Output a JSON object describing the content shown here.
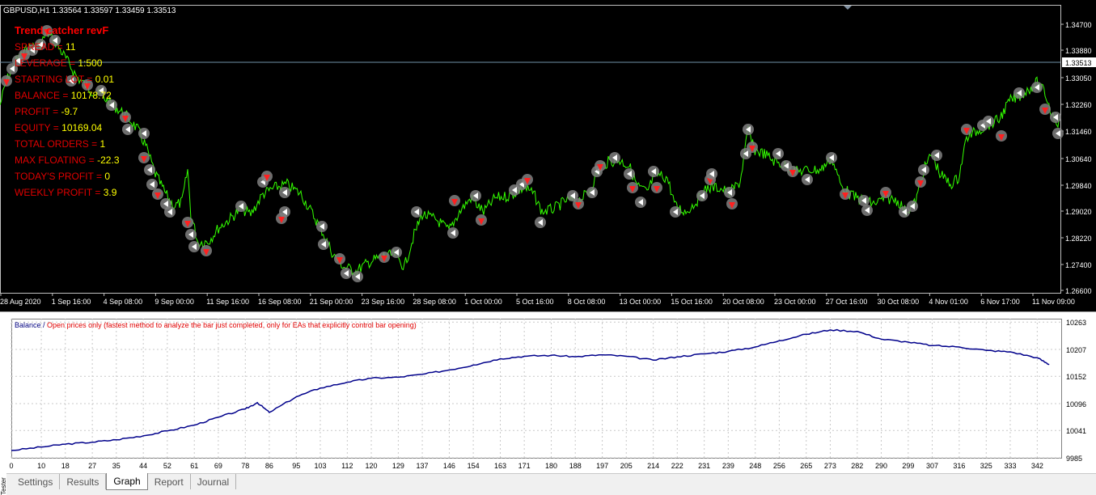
{
  "chart": {
    "title": "GBPUSD,H1  1.33564 1.33597 1.33459 1.33513",
    "price_axis": [
      "1.34700",
      "1.33880",
      "1.33513",
      "1.33050",
      "1.32260",
      "1.31460",
      "1.30640",
      "1.29840",
      "1.29020",
      "1.28220",
      "1.27400",
      "1.26600"
    ],
    "current_price": "1.33513",
    "time_axis": [
      "28 Aug 2020",
      "1 Sep 16:00",
      "4 Sep 08:00",
      "9 Sep 00:00",
      "11 Sep 16:00",
      "16 Sep 08:00",
      "21 Sep 00:00",
      "23 Sep 16:00",
      "28 Sep 08:00",
      "1 Oct 00:00",
      "5 Oct 16:00",
      "8 Oct 08:00",
      "13 Oct 00:00",
      "15 Oct 16:00",
      "20 Oct 08:00",
      "23 Oct 00:00",
      "27 Oct 16:00",
      "30 Oct 08:00",
      "4 Nov 01:00",
      "6 Nov 17:00",
      "11 Nov 09:00"
    ],
    "colors": {
      "background": "#000000",
      "price_line": "#33ff00",
      "buy_marker": "#ff2020",
      "exit_marker": "#808080"
    }
  },
  "stats": {
    "ea_name": "Trend catcher revF",
    "rows": [
      {
        "label": "SPREAD = ",
        "value": "11"
      },
      {
        "label": "LEVERAGE = ",
        "value": "1:500"
      },
      {
        "label": "STARTING LOT = ",
        "value": "0.01"
      },
      {
        "label": "BALANCE = ",
        "value": "10178.72"
      },
      {
        "label": "PROFIT = ",
        "value": "-9.7"
      },
      {
        "label": "EQUITY = ",
        "value": "10169.04"
      },
      {
        "label": "TOTAL ORDERS = ",
        "value": "1"
      },
      {
        "label": "MAX FLOATING = ",
        "value": "-22.3"
      },
      {
        "label": "TODAY'S PROFIT = ",
        "value": "0"
      },
      {
        "label": "WEEKLY PROFIT = ",
        "value": "3.9"
      }
    ]
  },
  "balance_graph": {
    "legend_balance": "Balance",
    "legend_sep": " / ",
    "legend_note": "Open prices only (fastest method to analyze the bar just completed, only for EAs that explicitly control bar opening)",
    "y_axis": [
      "10263",
      "10207",
      "10152",
      "10096",
      "10041",
      "9985"
    ],
    "x_axis": [
      "0",
      "10",
      "18",
      "27",
      "35",
      "44",
      "52",
      "61",
      "69",
      "78",
      "86",
      "95",
      "103",
      "112",
      "120",
      "129",
      "137",
      "146",
      "154",
      "163",
      "171",
      "180",
      "188",
      "197",
      "205",
      "214",
      "222",
      "231",
      "239",
      "248",
      "256",
      "265",
      "273",
      "282",
      "290",
      "299",
      "307",
      "316",
      "325",
      "333",
      "342"
    ],
    "line_color": "#00008b"
  },
  "chart_data": {
    "type": "line",
    "title": "",
    "xlabel": "",
    "ylabel": "",
    "x": [
      0,
      10,
      18,
      27,
      35,
      44,
      52,
      61,
      69,
      78,
      82,
      86,
      95,
      103,
      112,
      120,
      129,
      137,
      146,
      154,
      163,
      171,
      180,
      188,
      197,
      205,
      214,
      222,
      231,
      239,
      248,
      256,
      265,
      273,
      282,
      290,
      299,
      307,
      316,
      325,
      333,
      342,
      346
    ],
    "series": [
      {
        "name": "Balance",
        "values": [
          10000,
          10007,
          10013,
          10017,
          10022,
          10030,
          10040,
          10052,
          10068,
          10085,
          10098,
          10078,
          10110,
          10128,
          10140,
          10148,
          10150,
          10156,
          10165,
          10175,
          10188,
          10193,
          10195,
          10192,
          10196,
          10193,
          10185,
          10192,
          10198,
          10203,
          10212,
          10225,
          10238,
          10247,
          10244,
          10228,
          10222,
          10215,
          10212,
          10205,
          10202,
          10190,
          10176
        ]
      }
    ],
    "ylim": [
      9985,
      10270
    ],
    "grid": true
  },
  "tabs": [
    {
      "label": "Settings",
      "active": false
    },
    {
      "label": "Results",
      "active": false
    },
    {
      "label": "Graph",
      "active": true
    },
    {
      "label": "Report",
      "active": false
    },
    {
      "label": "Journal",
      "active": false
    }
  ],
  "side_label": "Tester"
}
